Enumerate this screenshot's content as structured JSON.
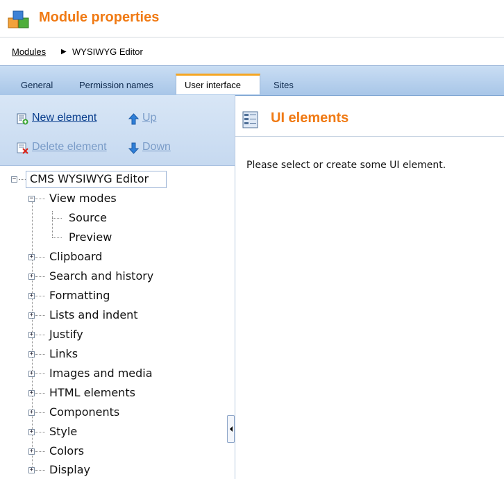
{
  "header": {
    "title": "Module properties",
    "icon": "module-boxes-icon"
  },
  "breadcrumb": {
    "link": "Modules",
    "separator": "▶",
    "current": "WYSIWYG Editor"
  },
  "tabs": [
    {
      "label": "General",
      "active": false
    },
    {
      "label": "Permission names",
      "active": false
    },
    {
      "label": "User interface",
      "active": true
    },
    {
      "label": "Sites",
      "active": false
    }
  ],
  "toolbar": {
    "new_element": "New element",
    "up": "Up",
    "delete_element": "Delete element",
    "down": "Down"
  },
  "tree": {
    "root": "CMS WYSIWYG Editor",
    "view_modes": "View modes",
    "view_modes_children": [
      "Source",
      "Preview"
    ],
    "items": [
      "Clipboard",
      "Search and history",
      "Formatting",
      "Lists and indent",
      "Justify",
      "Links",
      "Images and media",
      "HTML elements",
      "Components",
      "Style",
      "Colors",
      "Display"
    ]
  },
  "right": {
    "title": "UI elements",
    "message": "Please select or create some UI element."
  },
  "colors": {
    "accent": "#f07a14",
    "tab_bar": "#b4cfee",
    "link": "#083d8c"
  }
}
